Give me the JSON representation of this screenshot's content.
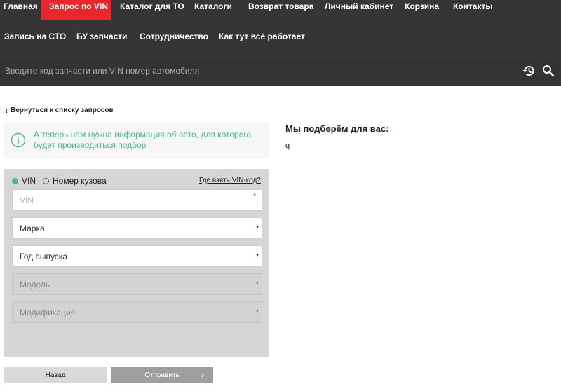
{
  "nav": {
    "row1": [
      {
        "label": "Главная",
        "active": false
      },
      {
        "label": "Запрос по VIN",
        "active": true
      },
      {
        "label": "Каталог для ТО",
        "active": false
      },
      {
        "label": "Каталоги",
        "active": false
      },
      {
        "label": "Возврат товара",
        "active": false
      },
      {
        "label": "Личный кабинет",
        "active": false
      },
      {
        "label": "Корзина",
        "active": false
      },
      {
        "label": "Контакты",
        "active": false
      }
    ],
    "row2": [
      {
        "label": "Запись на СТО"
      },
      {
        "label": "БУ запчасти"
      },
      {
        "label": "Сотрудничество"
      },
      {
        "label": "Как тут всё работает"
      }
    ]
  },
  "search": {
    "placeholder": "Введите код запчасти или VIN номер автомобиля",
    "value": "",
    "history_icon": "history-icon",
    "search_icon": "search-icon"
  },
  "back_link": {
    "chevron": "‹",
    "label": "Вернуться к списку запросов"
  },
  "info": {
    "icon": "info-icon",
    "text": "А теперь нам нужна информация об авто, для которого будет производиться подбор",
    "accent": "#49b883"
  },
  "form": {
    "radio_vin": "VIN",
    "radio_body": "Номер кузова",
    "vin_help": "Где взять VIN-код?",
    "vin_placeholder": "VIN",
    "required_mark": "*",
    "make": "Марка",
    "year": "Год выпуска",
    "model": "Модель",
    "modification": "Модификация"
  },
  "buttons": {
    "back": "Назад",
    "send": "Отправить",
    "send_arrow": "›"
  },
  "right": {
    "title": "Мы подберём для вас:",
    "text": "q"
  },
  "colors": {
    "header_bg": "#353535",
    "active_nav": "#e8262b",
    "accent_green": "#49b883",
    "panel_bg": "#d6d6d6"
  }
}
